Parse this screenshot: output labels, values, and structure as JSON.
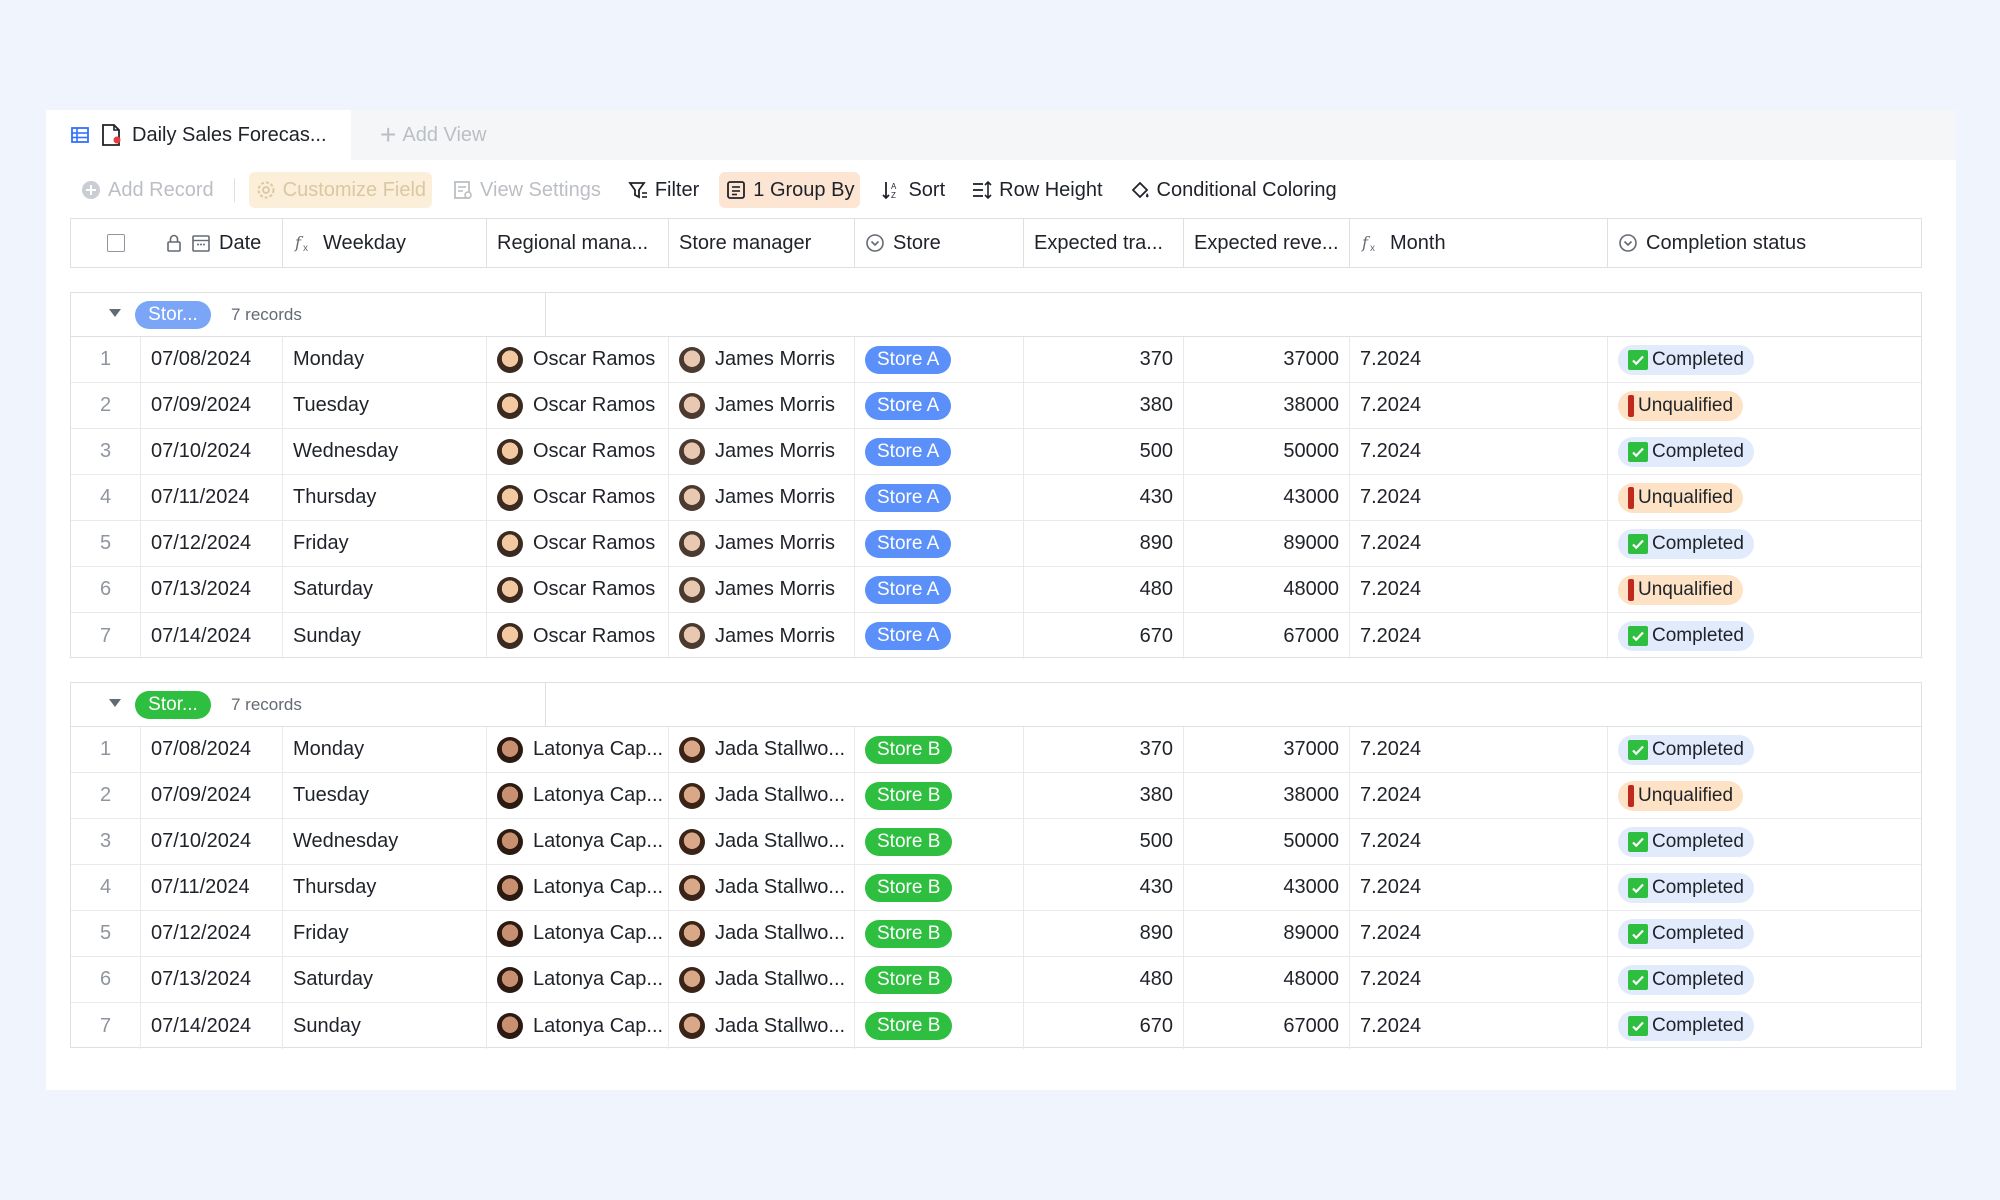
{
  "view_tab": {
    "title": "Daily Sales Forecas...",
    "add_view": "Add View"
  },
  "toolbar": {
    "add_record": "Add Record",
    "customize_field": "Customize Field",
    "view_settings": "View Settings",
    "filter": "Filter",
    "group_by": "1 Group By",
    "sort": "Sort",
    "row_height": "Row Height",
    "conditional_coloring": "Conditional Coloring"
  },
  "columns": {
    "date": "Date",
    "weekday": "Weekday",
    "regional_manager": "Regional mana...",
    "store_manager": "Store manager",
    "store": "Store",
    "expected_traffic": "Expected tra...",
    "expected_revenue": "Expected reve...",
    "month": "Month",
    "completion_status": "Completion status"
  },
  "colors": {
    "store_a": "#5b8ff9",
    "store_b": "#2fbf40",
    "completed_bg": "#e1ebfb",
    "unqualified_bg": "#fde2c6",
    "group_by_bg": "#fde5d4"
  },
  "groups": [
    {
      "label": "Stor...",
      "count": "7 records",
      "color": "#7ba6f7",
      "rows": [
        {
          "n": "1",
          "date": "07/08/2024",
          "weekday": "Monday",
          "regional": "Oscar Ramos",
          "manager": "James Morris",
          "store": "Store A",
          "traffic": "370",
          "revenue": "37000",
          "month": "7.2024",
          "status": "Completed"
        },
        {
          "n": "2",
          "date": "07/09/2024",
          "weekday": "Tuesday",
          "regional": "Oscar Ramos",
          "manager": "James Morris",
          "store": "Store A",
          "traffic": "380",
          "revenue": "38000",
          "month": "7.2024",
          "status": "Unqualified"
        },
        {
          "n": "3",
          "date": "07/10/2024",
          "weekday": "Wednesday",
          "regional": "Oscar Ramos",
          "manager": "James Morris",
          "store": "Store A",
          "traffic": "500",
          "revenue": "50000",
          "month": "7.2024",
          "status": "Completed"
        },
        {
          "n": "4",
          "date": "07/11/2024",
          "weekday": "Thursday",
          "regional": "Oscar Ramos",
          "manager": "James Morris",
          "store": "Store A",
          "traffic": "430",
          "revenue": "43000",
          "month": "7.2024",
          "status": "Unqualified"
        },
        {
          "n": "5",
          "date": "07/12/2024",
          "weekday": "Friday",
          "regional": "Oscar Ramos",
          "manager": "James Morris",
          "store": "Store A",
          "traffic": "890",
          "revenue": "89000",
          "month": "7.2024",
          "status": "Completed"
        },
        {
          "n": "6",
          "date": "07/13/2024",
          "weekday": "Saturday",
          "regional": "Oscar Ramos",
          "manager": "James Morris",
          "store": "Store A",
          "traffic": "480",
          "revenue": "48000",
          "month": "7.2024",
          "status": "Unqualified"
        },
        {
          "n": "7",
          "date": "07/14/2024",
          "weekday": "Sunday",
          "regional": "Oscar Ramos",
          "manager": "James Morris",
          "store": "Store A",
          "traffic": "670",
          "revenue": "67000",
          "month": "7.2024",
          "status": "Completed"
        }
      ]
    },
    {
      "label": "Stor...",
      "count": "7 records",
      "color": "#2fbf40",
      "rows": [
        {
          "n": "1",
          "date": "07/08/2024",
          "weekday": "Monday",
          "regional": "Latonya Cap...",
          "manager": "Jada Stallwo...",
          "store": "Store B",
          "traffic": "370",
          "revenue": "37000",
          "month": "7.2024",
          "status": "Completed"
        },
        {
          "n": "2",
          "date": "07/09/2024",
          "weekday": "Tuesday",
          "regional": "Latonya Cap...",
          "manager": "Jada Stallwo...",
          "store": "Store B",
          "traffic": "380",
          "revenue": "38000",
          "month": "7.2024",
          "status": "Unqualified"
        },
        {
          "n": "3",
          "date": "07/10/2024",
          "weekday": "Wednesday",
          "regional": "Latonya Cap...",
          "manager": "Jada Stallwo...",
          "store": "Store B",
          "traffic": "500",
          "revenue": "50000",
          "month": "7.2024",
          "status": "Completed"
        },
        {
          "n": "4",
          "date": "07/11/2024",
          "weekday": "Thursday",
          "regional": "Latonya Cap...",
          "manager": "Jada Stallwo...",
          "store": "Store B",
          "traffic": "430",
          "revenue": "43000",
          "month": "7.2024",
          "status": "Completed"
        },
        {
          "n": "5",
          "date": "07/12/2024",
          "weekday": "Friday",
          "regional": "Latonya Cap...",
          "manager": "Jada Stallwo...",
          "store": "Store B",
          "traffic": "890",
          "revenue": "89000",
          "month": "7.2024",
          "status": "Completed"
        },
        {
          "n": "6",
          "date": "07/13/2024",
          "weekday": "Saturday",
          "regional": "Latonya Cap...",
          "manager": "Jada Stallwo...",
          "store": "Store B",
          "traffic": "480",
          "revenue": "48000",
          "month": "7.2024",
          "status": "Completed"
        },
        {
          "n": "7",
          "date": "07/14/2024",
          "weekday": "Sunday",
          "regional": "Latonya Cap...",
          "manager": "Jada Stallwo...",
          "store": "Store B",
          "traffic": "670",
          "revenue": "67000",
          "month": "7.2024",
          "status": "Completed"
        }
      ]
    }
  ]
}
